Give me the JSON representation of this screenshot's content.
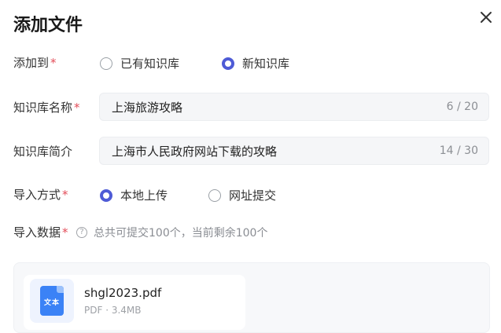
{
  "dialog": {
    "title": "添加文件"
  },
  "form": {
    "add_to": {
      "label": "添加到",
      "required_mark": "*",
      "options": [
        {
          "label": "已有知识库",
          "checked": false
        },
        {
          "label": "新知识库",
          "checked": true
        }
      ]
    },
    "kb_name": {
      "label": "知识库名称",
      "required_mark": "*",
      "value": "上海旅游攻略",
      "count": "6 / 20"
    },
    "kb_intro": {
      "label": "知识库简介",
      "value": "上海市人民政府网站下载的攻略",
      "count": "14 / 30"
    },
    "import_method": {
      "label": "导入方式",
      "required_mark": "*",
      "options": [
        {
          "label": "本地上传",
          "checked": true
        },
        {
          "label": "网址提交",
          "checked": false
        }
      ]
    },
    "import_data": {
      "label": "导入数据",
      "required_mark": "*",
      "help_icon": "question-circle-icon",
      "hint": "总共可提交100个，当前剩余100个"
    }
  },
  "files": [
    {
      "icon_text": "文本",
      "name": "shgl2023.pdf",
      "meta": "PDF · 3.4MB"
    }
  ],
  "colors": {
    "accent": "#4e5bd6",
    "required": "#e34d59",
    "file_icon": "#3b82f6"
  }
}
